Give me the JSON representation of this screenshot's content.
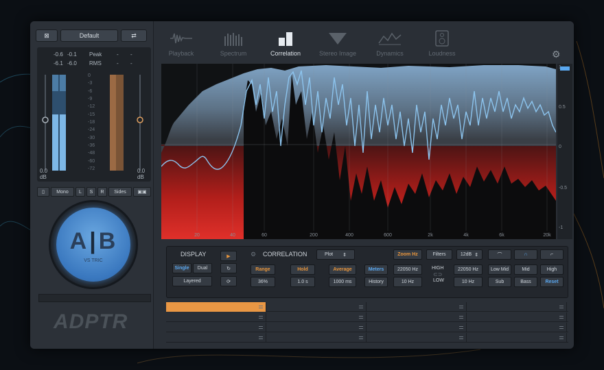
{
  "colors": {
    "accent_blue": "#5aa8f0",
    "accent_orange": "#e99744",
    "panel": "#2a2f36",
    "red_fill": "#c8231e"
  },
  "left": {
    "preset": "Default",
    "peak_label": "Peak",
    "rms_label": "RMS",
    "peak_values": [
      "-0.6",
      "-0.1"
    ],
    "rms_values": [
      "-6.1",
      "-6.0"
    ],
    "dash": "-",
    "scale_labels": [
      "0",
      "-3",
      "-6",
      "-9",
      "-12",
      "-15",
      "-18",
      "-24",
      "-30",
      "-36",
      "-48",
      "-60",
      "-72"
    ],
    "gain_left_value": "0.0",
    "gain_left_unit": "dB",
    "gain_right_value": "0.0",
    "gain_right_unit": "dB",
    "mode_buttons": [
      "Mono",
      "L",
      "S",
      "R",
      "Sides"
    ],
    "ab_left": "A",
    "ab_right": "B",
    "ab_sub": "VS TRIC",
    "logo": "ADPTR"
  },
  "tabs": [
    {
      "label": "Playback",
      "icon": "playback-waveform-icon"
    },
    {
      "label": "Spectrum",
      "icon": "spectrum-bars-icon"
    },
    {
      "label": "Correlation",
      "icon": "correlation-bars-icon",
      "active": true
    },
    {
      "label": "Stereo Image",
      "icon": "stereo-image-icon"
    },
    {
      "label": "Dynamics",
      "icon": "dynamics-icon"
    },
    {
      "label": "Loudness",
      "icon": "speaker-icon"
    }
  ],
  "graph": {
    "x_ticks": [
      "20",
      "40",
      "60",
      "200",
      "400",
      "600",
      "2k",
      "4k",
      "6k",
      "20k"
    ],
    "y_ticks": [
      "1",
      "0.5",
      "0",
      "-0.5",
      "-1"
    ]
  },
  "controls": {
    "display_title": "DISPLAY",
    "single": "Single",
    "dual": "Dual",
    "layered": "Layered",
    "correlation_title": "CORRELATION",
    "plot_select": "Plot",
    "range_label": "Range",
    "range_value": "36%",
    "hold_label": "Hold",
    "hold_value": "1.0 s",
    "average_label": "Average",
    "average_value": "1000 ms",
    "meters": "Meters",
    "history": "History",
    "zoom_hz": "Zoom Hz",
    "filters": "Filters",
    "slope": "12dB",
    "hz_high_1": "22050 Hz",
    "hz_low_1": "10 Hz",
    "high": "HIGH",
    "low": "LOW",
    "hz_high_2": "22050 Hz",
    "hz_low_2": "10 Hz",
    "low_mid": "Low Mid",
    "mid": "Mid",
    "high_band": "High",
    "sub": "Sub",
    "bass": "Bass",
    "reset": "Reset"
  }
}
